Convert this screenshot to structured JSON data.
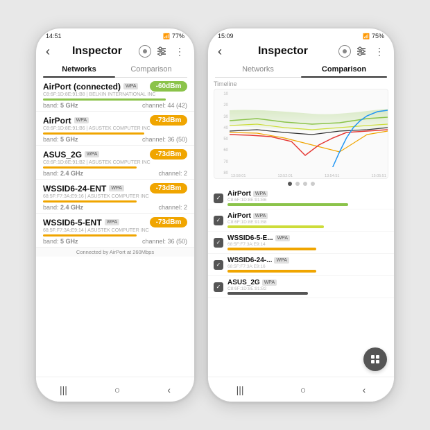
{
  "leftPhone": {
    "statusBar": {
      "time": "14:51",
      "signal": "▲▼",
      "battery": "77%"
    },
    "header": {
      "title": "Inspector",
      "backLabel": "‹",
      "circleIcon": "○",
      "tuneIcon": "⊟",
      "moreIcon": "⋮"
    },
    "tabs": [
      {
        "label": "Networks",
        "active": true
      },
      {
        "label": "Comparison",
        "active": false
      }
    ],
    "networks": [
      {
        "name": "AirPort (connected)",
        "badge": "WPA",
        "mac": "C8:6F:1D:8E:91:B8 | BELKIN INTERNATIONAL INC",
        "signal": "-60dBm",
        "signalClass": "good",
        "barWidth": "85%",
        "barClass": "good",
        "band": "5 GHz",
        "channel": "44 (42)"
      },
      {
        "name": "AirPort",
        "badge": "WPA",
        "mac": "C8:6F:1D:8E:91:B6 | ASUSTEK COMPUTER INC",
        "signal": "-73dBm",
        "signalClass": "",
        "barWidth": "70%",
        "barClass": "",
        "band": "5 GHz",
        "channel": "36 (50)"
      },
      {
        "name": "ASUS_2G",
        "badge": "WPA",
        "mac": "C8:6F:1D:8E:91:B2 | ASUSTEK COMPUTER INC",
        "signal": "-73dBm",
        "signalClass": "",
        "barWidth": "65%",
        "barClass": "",
        "band": "2.4 GHz",
        "channel": "2"
      },
      {
        "name": "WSSID6-24-ENT",
        "badge": "WPA",
        "mac": "68:5F:F7:3A:E9:16 | ASUSTEK COMPUTER INC",
        "signal": "-73dBm",
        "signalClass": "",
        "barWidth": "65%",
        "barClass": "",
        "band": "2.4 GHz",
        "channel": "2"
      },
      {
        "name": "WSSID6-5-ENT",
        "badge": "WPA",
        "mac": "68:5F:F7:3A:E9:14 | ASUSTEK COMPUTER INC",
        "signal": "-73dBm",
        "signalClass": "",
        "barWidth": "65%",
        "barClass": "",
        "band": "5 GHz",
        "channel": "36 (50)"
      }
    ],
    "connectedBar": "Connected by AirPort at 260Mbps",
    "bottomNav": [
      "|||",
      "○",
      "‹"
    ]
  },
  "rightPhone": {
    "statusBar": {
      "time": "15:09",
      "signal": "▲▼",
      "battery": "75%"
    },
    "header": {
      "title": "Inspector",
      "backLabel": "‹",
      "circleIcon": "○",
      "tuneIcon": "⊟",
      "moreIcon": "⋮"
    },
    "tabs": [
      {
        "label": "Networks",
        "active": false
      },
      {
        "label": "Comparison",
        "active": true
      }
    ],
    "chart": {
      "title": "Timeline",
      "yLabels": [
        "10",
        "20",
        "30",
        "40",
        "50",
        "60",
        "70",
        "80"
      ],
      "xLabels": [
        "13:58:01",
        "13:52:01",
        "13:54:51",
        "15:05:51"
      ],
      "dots": [
        true,
        false,
        false,
        false
      ]
    },
    "compItems": [
      {
        "name": "AirPort",
        "badge": "WPA",
        "mac": "C8:6F:1D:8E:91:B6",
        "barWidth": "75%",
        "barColor": "#8bc34a",
        "checked": true
      },
      {
        "name": "AirPort",
        "badge": "WPA",
        "mac": "C8:6F:1D:8E:91:B8",
        "barWidth": "60%",
        "barColor": "#cddc39",
        "checked": true
      },
      {
        "name": "WSSID6-5-E...",
        "badge": "WPA",
        "mac": "68:5F:F7:3A:E9:14",
        "barWidth": "55%",
        "barColor": "#f0a500",
        "checked": true
      },
      {
        "name": "WSSID6-24-...",
        "badge": "WPA",
        "mac": "68:5F:F7:3A:E9:16",
        "barWidth": "55%",
        "barColor": "#f0a500",
        "checked": true
      },
      {
        "name": "ASUS_2G",
        "badge": "WPA",
        "mac": "C8:6F:1D:8E:91:B2",
        "barWidth": "50%",
        "barColor": "#555",
        "checked": true
      }
    ],
    "fabIcon": "⊞",
    "bottomNav": [
      "|||",
      "○",
      "‹"
    ]
  }
}
